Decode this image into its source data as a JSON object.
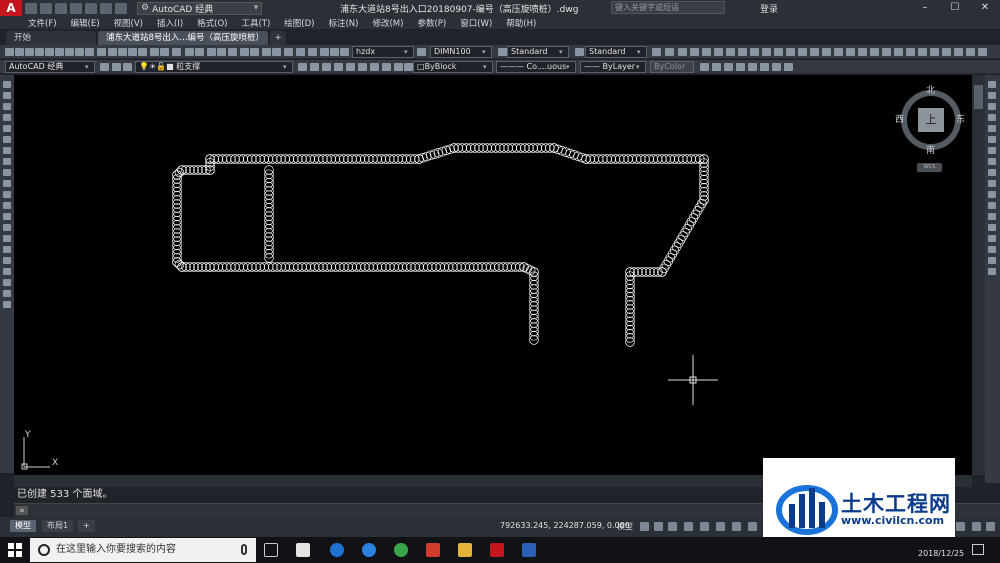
{
  "app": {
    "logo_letter": "A",
    "workspace": "AutoCAD 经典",
    "title": "浦东大道站8号出入口20180907-编号（高压旋喷桩）.dwg",
    "search_placeholder": "键入关键字或短语",
    "login_label": "登录",
    "minimize": "–",
    "maximize": "☐",
    "close": "✕"
  },
  "menu": [
    "文件(F)",
    "编辑(E)",
    "视图(V)",
    "插入(I)",
    "格式(O)",
    "工具(T)",
    "绘图(D)",
    "标注(N)",
    "修改(M)",
    "参数(P)",
    "窗口(W)",
    "帮助(H)"
  ],
  "tabs": {
    "home": "开始",
    "active": "浦东大道站8号出入...编号（高压旋喷桩）*",
    "close": "×",
    "add": "+"
  },
  "toolbar1": {
    "text_style": "hzdx",
    "dim_style": "DIMN100",
    "table_style": "Standard",
    "multileader_style": "Standard"
  },
  "toolbar2": {
    "workspace": "AutoCAD 经典",
    "layer": "粒支撑",
    "color": "ByBlock",
    "linetype": "Co....uous",
    "lineweight": "ByLayer",
    "plotstyle": "ByColor"
  },
  "viewcube": {
    "north": "北",
    "south": "南",
    "east": "东",
    "west": "西",
    "face": "上",
    "wcs": "WCS"
  },
  "ucs": {
    "x": "X",
    "y": "Y"
  },
  "command": {
    "history": "已创建  533  个面域。",
    "prompt_icon": "≥",
    "input_placeholder": ""
  },
  "layout_tabs": [
    "模型",
    "布局1",
    "+"
  ],
  "status": {
    "coords": "792633.245, 224287.059, 0.000",
    "model": "模型"
  },
  "watermark": {
    "title": "土木工程网",
    "url": "www.civilcn.com"
  },
  "taskbar": {
    "search_text": "在这里输入你要搜索的内容",
    "date": "2018/12/25"
  },
  "colors": {
    "canvas": "#000000",
    "circles": "#ffffff",
    "accent_red": "#c4161c",
    "watermark_blue": "#0b3b8a"
  }
}
